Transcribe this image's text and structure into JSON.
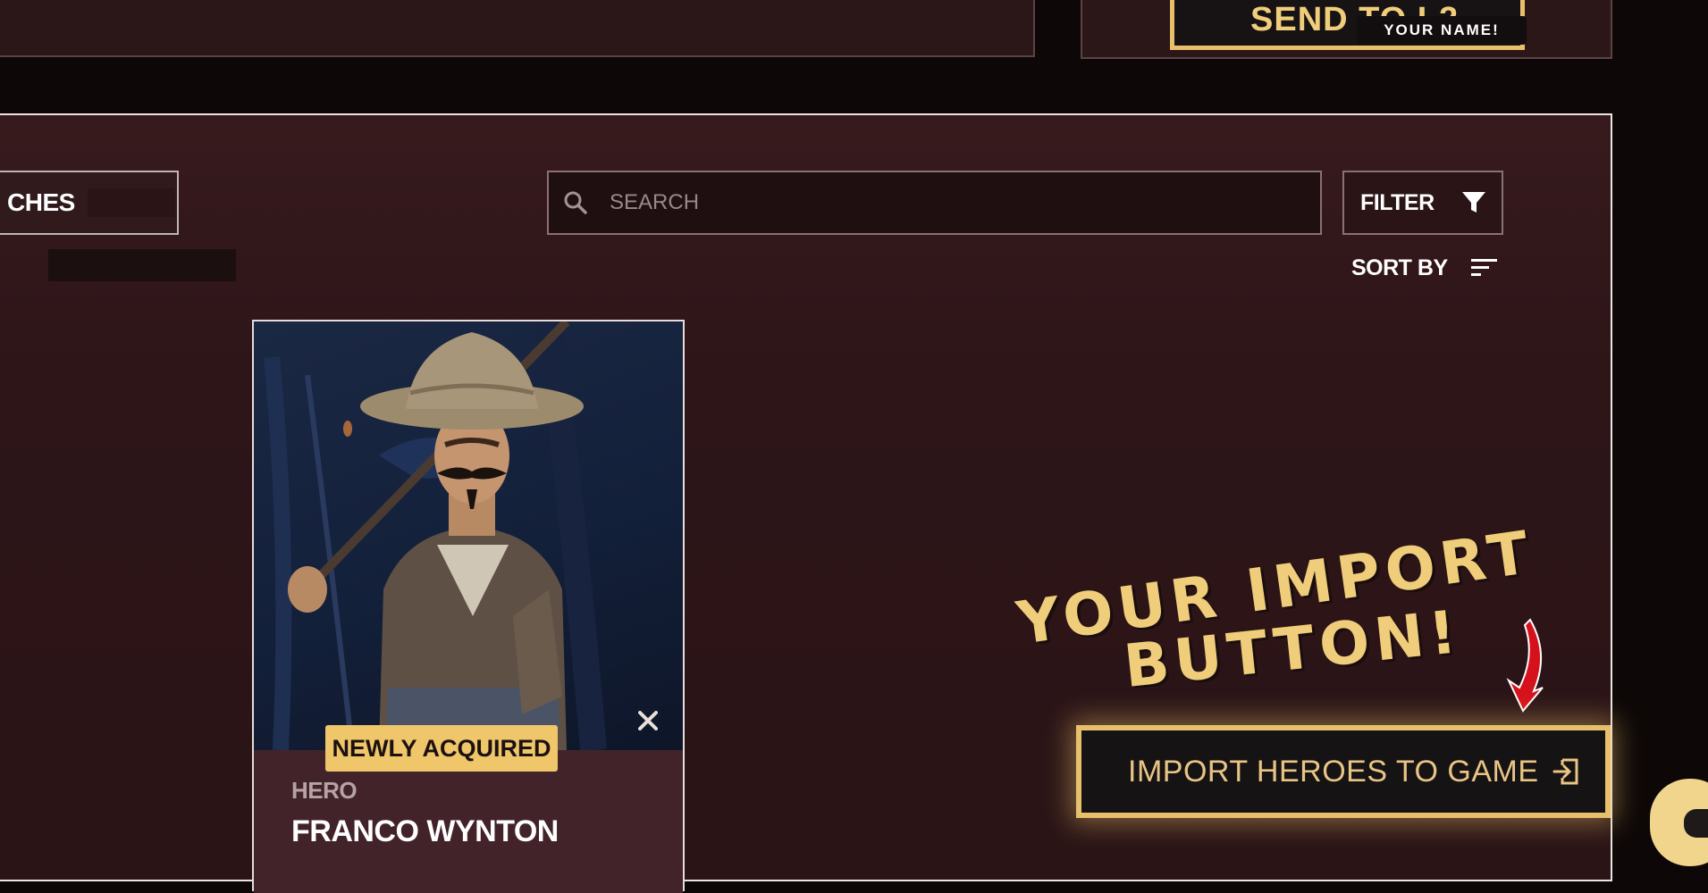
{
  "top_bar": {
    "send_button_label": "SEND TO L2",
    "name_tag": "YOUR NAME!"
  },
  "tabs": {
    "partial_tab_label": "CHES"
  },
  "search": {
    "placeholder": "SEARCH",
    "value": ""
  },
  "filter": {
    "label": "FILTER",
    "icon": "filter-icon"
  },
  "sort": {
    "label": "SORT BY",
    "icon": "sort-icon"
  },
  "hero_card": {
    "badge": "NEWLY ACQUIRED",
    "type": "HERO",
    "name": "FRANCO WYNTON",
    "corner_icon": "x-logo-icon"
  },
  "annotation": {
    "line1": "YOUR IMPORT",
    "line2": "BUTTON!"
  },
  "import_button": {
    "label": "IMPORT HEROES TO GAME",
    "icon": "import-icon"
  },
  "colors": {
    "gold": "#e8bf6a",
    "panel_bg": "#2d1518",
    "badge_bg": "#f0c66a",
    "arrow_red": "#d5121b"
  }
}
